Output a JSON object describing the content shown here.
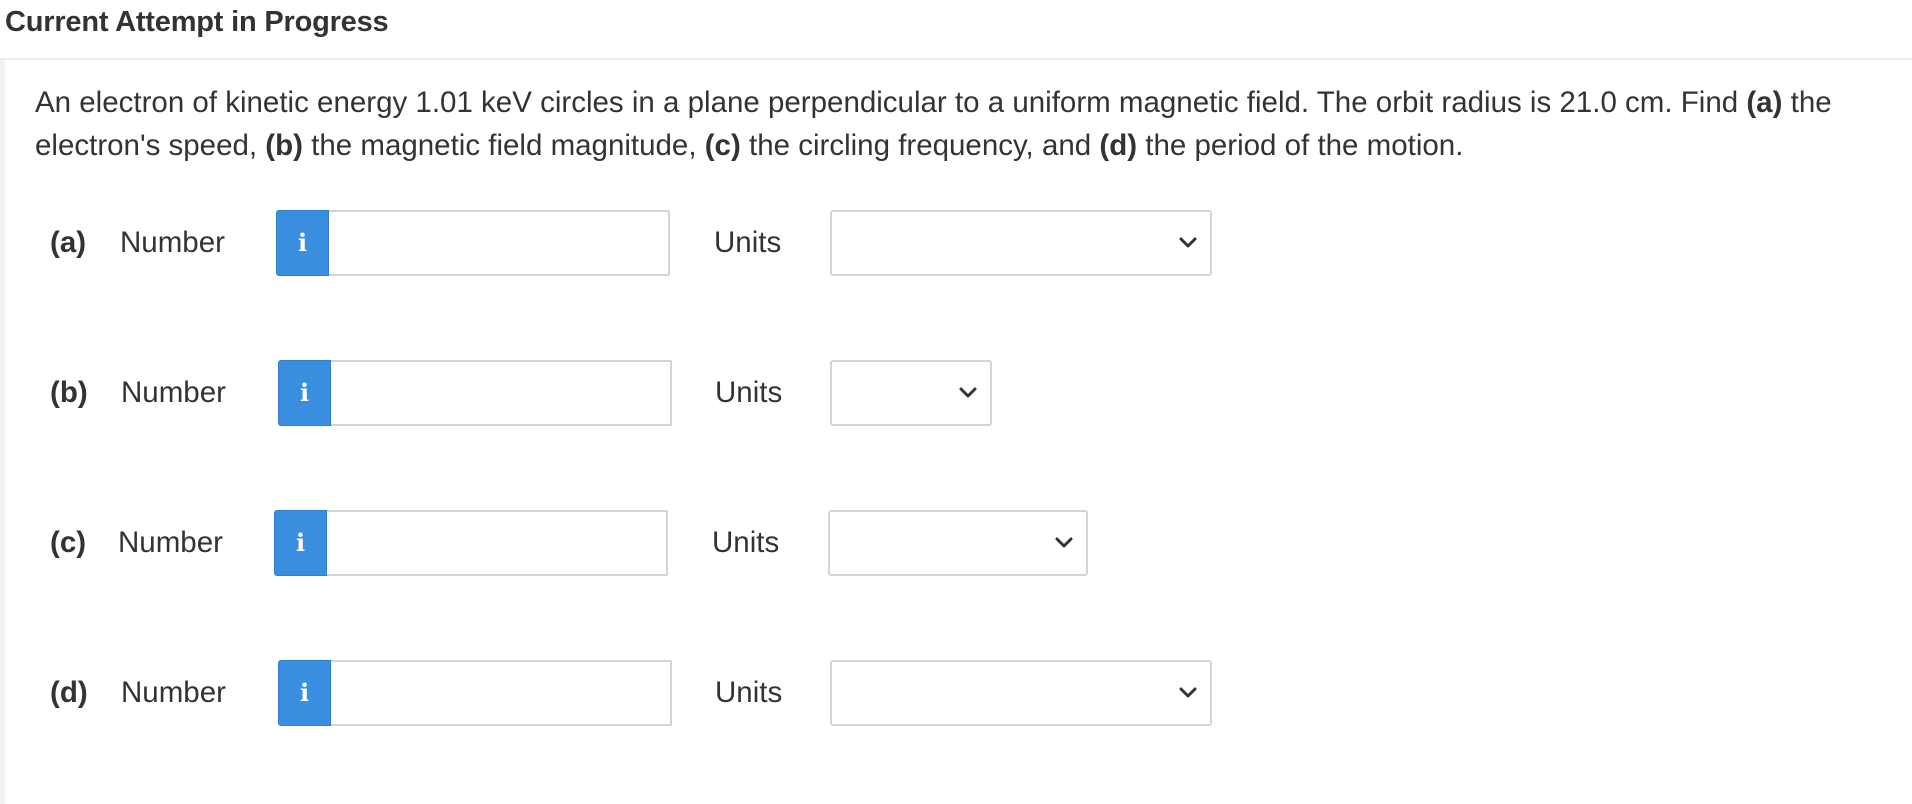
{
  "header": {
    "title": "Current Attempt in Progress"
  },
  "question": {
    "text_1": "An electron of kinetic energy 1.01 keV circles in a plane perpendicular to a uniform magnetic field. The orbit radius is 21.0 cm. Find ",
    "part_a": "(a)",
    "text_2": " the electron's speed, ",
    "part_b": "(b)",
    "text_3": " the magnetic field magnitude, ",
    "part_c": "(c)",
    "text_4": " the circling frequency, and ",
    "part_d": "(d)",
    "text_5": " the period of the motion."
  },
  "parts": [
    {
      "label": "(a)",
      "number_label": "Number",
      "info_icon": "info-icon",
      "number_value": "",
      "units_label": "Units",
      "units_selected": ""
    },
    {
      "label": "(b)",
      "number_label": "Number",
      "info_icon": "info-icon",
      "number_value": "",
      "units_label": "Units",
      "units_selected": ""
    },
    {
      "label": "(c)",
      "number_label": "Number",
      "info_icon": "info-icon",
      "number_value": "",
      "units_label": "Units",
      "units_selected": ""
    },
    {
      "label": "(d)",
      "number_label": "Number",
      "info_icon": "info-icon",
      "number_value": "",
      "units_label": "Units",
      "units_selected": ""
    }
  ],
  "colors": {
    "info_button": "#3a8ee0",
    "text": "#333333",
    "input_border": "#d4d4d4"
  }
}
